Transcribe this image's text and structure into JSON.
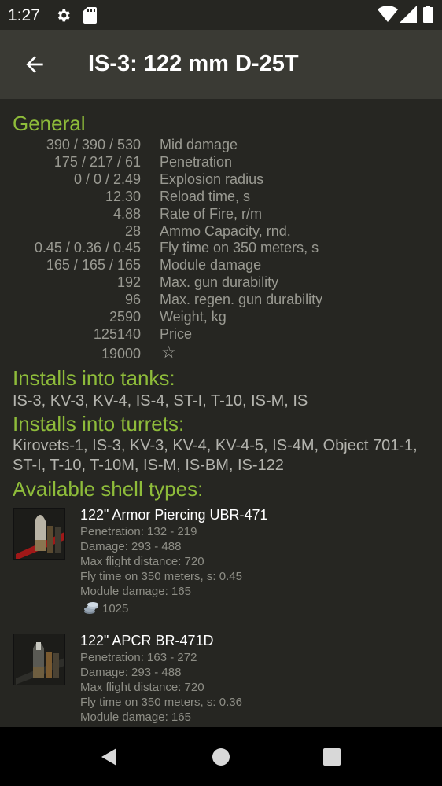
{
  "status": {
    "time": "1:27"
  },
  "appbar": {
    "title": "IS-3: 122 mm D-25T"
  },
  "general": {
    "heading": "General",
    "rows": [
      {
        "value": "390 / 390 / 530",
        "label": "Mid damage"
      },
      {
        "value": "175 / 217 / 61",
        "label": "Penetration"
      },
      {
        "value": "0 / 0 / 2.49",
        "label": "Explosion radius"
      },
      {
        "value": "12.30",
        "label": "Reload time, s"
      },
      {
        "value": "4.88",
        "label": "Rate of Fire, r/m"
      },
      {
        "value": "28",
        "label": "Ammo Capacity, rnd."
      },
      {
        "value": "0.45 / 0.36 / 0.45",
        "label": "Fly time on 350 meters, s"
      },
      {
        "value": "165 / 165 / 165",
        "label": "Module damage"
      },
      {
        "value": "192",
        "label": "Max. gun durability"
      },
      {
        "value": "96",
        "label": "Max. regen. gun durability"
      },
      {
        "value": "2590",
        "label": "Weight, kg"
      },
      {
        "value": "125140",
        "label": "Price"
      },
      {
        "value": "19000",
        "label": "☆"
      }
    ]
  },
  "tanks": {
    "heading": "Installs into tanks:",
    "text": "IS-3, KV-3, KV-4, IS-4, ST-I, T-10, IS-M, IS"
  },
  "turrets": {
    "heading": "Installs into turrets:",
    "text": "Kirovets-1, IS-3, KV-3, KV-4, KV-4-5, IS-4M, Object 701-1, ST-I, T-10, T-10M, IS-M, IS-BM, IS-122"
  },
  "shells": {
    "heading": "Available shell types:",
    "items": [
      {
        "name": "122\" Armor Piercing UBR-471",
        "penetration": "Penetration: 132 - 219",
        "damage": "Damage: 293 - 488",
        "distance": "Max flight distance: 720",
        "flytime": "Fly time on 350 meters, s: 0.45",
        "module": "Module damage: 165",
        "price": "1025"
      },
      {
        "name": "122\" APCR BR-471D",
        "penetration": "Penetration: 163 - 272",
        "damage": "Damage: 293 - 488",
        "distance": "Max flight distance: 720",
        "flytime": "Fly time on 350 meters, s: 0.36",
        "module": "Module damage: 165"
      }
    ]
  },
  "icons": {
    "settings": "gear-icon",
    "sdcard": "sd-card-icon",
    "wifi": "wifi-icon",
    "signal": "cell-signal-icon",
    "battery": "battery-icon",
    "back": "arrow-back-icon",
    "nav_back": "nav-back-icon",
    "nav_home": "nav-home-icon",
    "nav_recent": "nav-recents-icon",
    "credits": "credits-icon"
  },
  "colors": {
    "accent": "#8ebc3a",
    "background": "#262622",
    "appbar": "#3a3a34"
  }
}
